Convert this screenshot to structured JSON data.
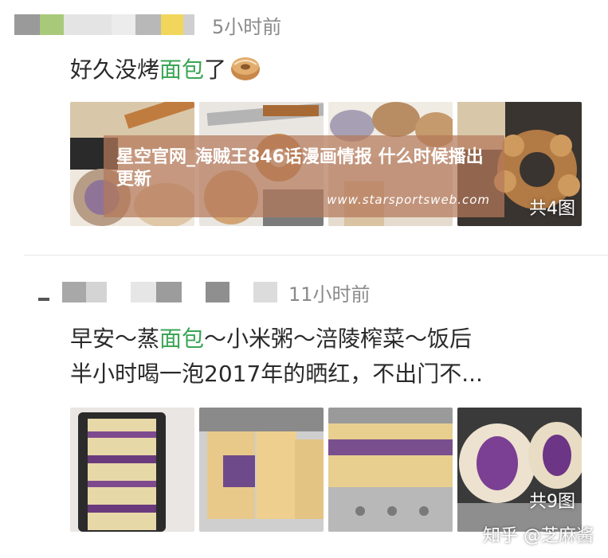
{
  "post1": {
    "time": "5小时前",
    "text_before": "好久没烤",
    "text_highlight": "面包",
    "text_after": "了",
    "emoji_icon": "bagel-icon",
    "image_count": "共4图"
  },
  "post2": {
    "time": "11小时前",
    "line1_before": "早安～蒸",
    "line1_highlight": "面包",
    "line1_after": "～小米粥～涪陵榨菜～饭后",
    "line2": "半小时喝一泡2017年的晒红，不出门不...",
    "image_count": "共9图"
  },
  "banner": {
    "title": "星空官网_海贼王846话漫画情报 什么时候播出更新",
    "url": "www.starsportsweb.com"
  },
  "watermark": {
    "text": "知乎 @芝麻酱"
  },
  "colors": {
    "highlight": "#3aa655",
    "time": "#8a8a8a",
    "banner_bg": "rgba(180,120,90,0.72)"
  }
}
